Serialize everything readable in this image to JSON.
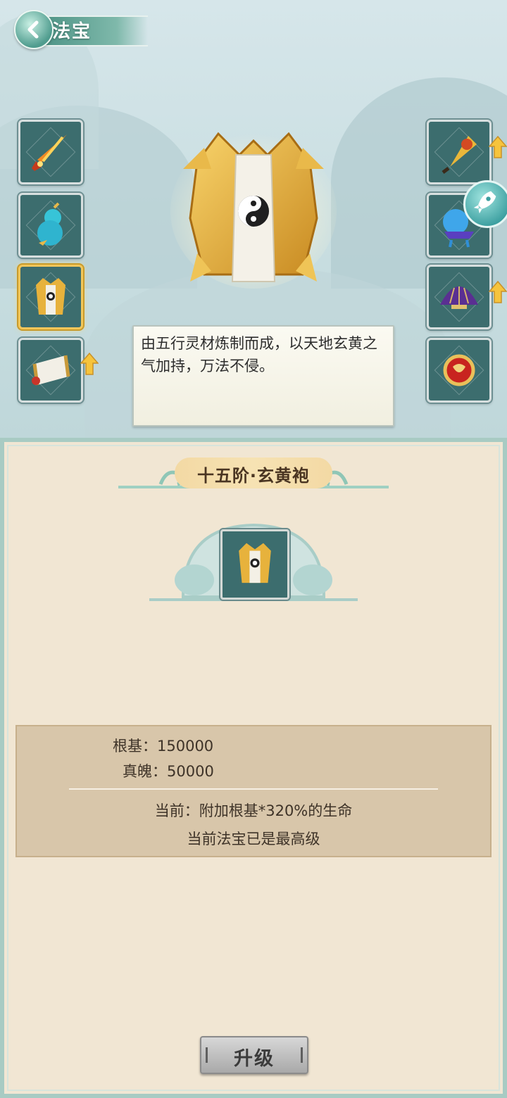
{
  "header": {
    "title": "法宝",
    "back_icon": "chevron-left-icon"
  },
  "left_slots": [
    {
      "name": "flame-sword",
      "active": false
    },
    {
      "name": "cyan-gourd",
      "active": false
    },
    {
      "name": "golden-robe",
      "active": true
    },
    {
      "name": "scroll",
      "active": false,
      "upgradable": true
    }
  ],
  "right_slots": [
    {
      "name": "golden-fan",
      "upgradable": true
    },
    {
      "name": "blue-orb",
      "upgradable": false
    },
    {
      "name": "purple-fan",
      "upgradable": true
    },
    {
      "name": "red-gem",
      "upgradable": false
    }
  ],
  "description": "由五行灵材炼制而成，以天地玄黄之气加持，万法不侵。",
  "panel": {
    "tier_title": "十五阶·玄黄袍",
    "stats": [
      {
        "label": "根基：",
        "value": "150000"
      },
      {
        "label": "真魄：",
        "value": "50000"
      }
    ],
    "current_effect": "当前：附加根基*320%的生命",
    "max_level_note": "当前法宝已是最高级",
    "upgrade_label": "升级"
  },
  "colors": {
    "accent": "#f2c65a",
    "panel_bg": "#f1e6d3",
    "slot_bg": "#3c6d6e"
  }
}
